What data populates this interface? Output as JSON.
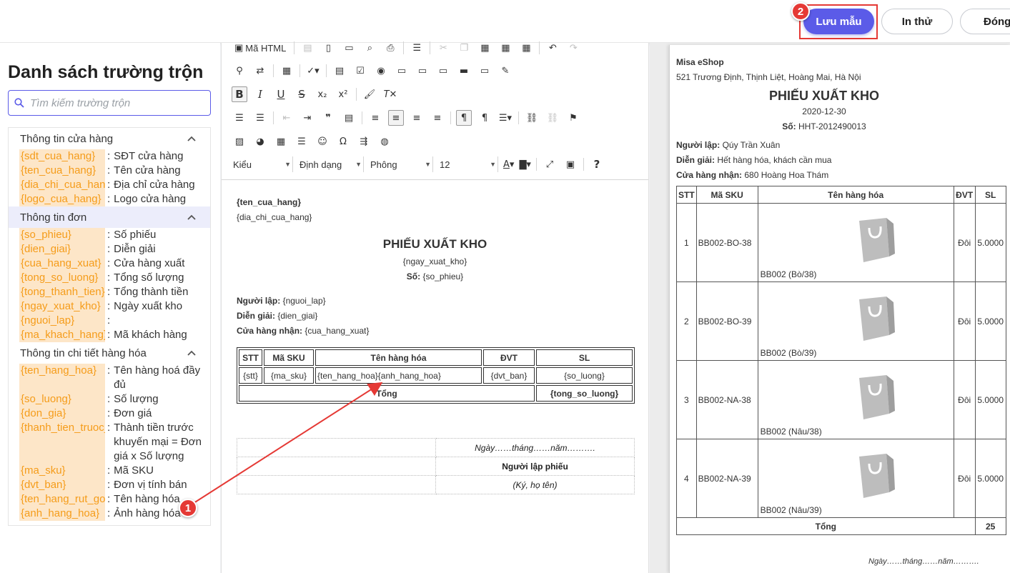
{
  "header": {
    "save_label": "Lưu mẫu",
    "test_print_label": "In thử",
    "close_label": "Đóng"
  },
  "markers": {
    "one": "1",
    "two": "2"
  },
  "colors": {
    "accent": "#5b5be8",
    "field_key_bg": "#fde6c8",
    "field_key_text": "#f59c1a",
    "marker": "#e53935"
  },
  "field_panel": {
    "title": "Danh sách trường trộn",
    "search_placeholder": "Tìm kiếm trường trộn",
    "groups": [
      {
        "title": "Thông tin cửa hàng",
        "fields": [
          {
            "key": "{sdt_cua_hang}",
            "desc": "SĐT cửa hàng"
          },
          {
            "key": "{ten_cua_hang}",
            "desc": "Tên cửa hàng"
          },
          {
            "key": "{dia_chi_cua_hang}",
            "desc": "Địa chỉ cửa hàng"
          },
          {
            "key": "{logo_cua_hang}",
            "desc": "Logo cửa hàng"
          }
        ]
      },
      {
        "title": "Thông tin đơn",
        "fields": [
          {
            "key": "{so_phieu}",
            "desc": "Số phiếu"
          },
          {
            "key": "{dien_giai}",
            "desc": "Diễn giải"
          },
          {
            "key": "{cua_hang_xuat}",
            "desc": "Cửa hàng xuất"
          },
          {
            "key": "{tong_so_luong}",
            "desc": "Tổng số lượng"
          },
          {
            "key": "{tong_thanh_tien}",
            "desc": "Tổng thành tiền"
          },
          {
            "key": "{ngay_xuat_kho}",
            "desc": "Ngày xuất kho"
          },
          {
            "key": "{nguoi_lap}",
            "desc": ""
          },
          {
            "key": "{ma_khach_hang}",
            "desc": "Mã khách hàng"
          }
        ]
      },
      {
        "title": "Thông tin chi tiết hàng hóa",
        "fields": [
          {
            "key": "{ten_hang_hoa}",
            "desc": "Tên hàng hoá đầy đủ"
          },
          {
            "key": "{so_luong}",
            "desc": "Số lượng"
          },
          {
            "key": "{don_gia}",
            "desc": "Đơn giá"
          },
          {
            "key": "{thanh_tien_truoc_km}",
            "desc": "Thành tiền trước khuyến mại = Đơn giá x Số lượng"
          },
          {
            "key": "{ma_sku}",
            "desc": "Mã SKU"
          },
          {
            "key": "{dvt_ban}",
            "desc": "Đơn vị tính bán"
          },
          {
            "key": "{ten_hang_rut_gon}",
            "desc": "Tên hàng hóa"
          },
          {
            "key": "{anh_hang_hoa}",
            "desc": "Ảnh hàng hóa"
          }
        ]
      }
    ]
  },
  "toolbar": {
    "html_label": "Mã HTML",
    "style_combo": "Kiểu",
    "format_combo": "Định dạng",
    "font_combo": "Phông",
    "size_combo": "12"
  },
  "template_doc": {
    "store_name": "{ten_cua_hang}",
    "store_address": "{dia_chi_cua_hang}",
    "title": "PHIẾU XUẤT KHO",
    "date": "{ngay_xuat_kho}",
    "number_label": "Số:",
    "number_value": "{so_phieu}",
    "creator_label": "Người lập:",
    "creator_value": "{nguoi_lap}",
    "desc_label": "Diễn giải:",
    "desc_value": "{dien_giai}",
    "store_recv_label": "Cửa hàng nhận:",
    "store_recv_value": "{cua_hang_xuat}",
    "table": {
      "headers": [
        "STT",
        "Mã SKU",
        "Tên hàng hóa",
        "ĐVT",
        "SL"
      ],
      "row": [
        "{stt}",
        "{ma_sku}",
        "{ten_hang_hoa}{anh_hang_hoa}",
        "{dvt_ban}",
        "{so_luong}"
      ],
      "total_label": "Tổng",
      "total_value": "{tong_so_luong}"
    },
    "sign_date": "Ngày……tháng……năm……….",
    "sign_title": "Người lập phiếu",
    "sign_note": "(Ký, họ tên)"
  },
  "preview_doc": {
    "store_name": "Misa eShop",
    "store_address": "521 Trương Định, Thịnh Liệt, Hoàng Mai, Hà Nội",
    "title": "PHIẾU XUẤT KHO",
    "date": "2020-12-30",
    "number_label": "Số:",
    "number_value": "HHT-2012490013",
    "creator_label": "Người lập:",
    "creator_value": "Qúy Trần Xuân",
    "desc_label": "Diễn giải:",
    "desc_value": "Hết hàng hóa, khách cần mua",
    "store_recv_label": "Cửa hàng nhận:",
    "store_recv_value": "680 Hoàng Hoa Thám",
    "table": {
      "headers": [
        "STT",
        "Mã SKU",
        "Tên hàng hóa",
        "ĐVT",
        "SL"
      ],
      "rows": [
        {
          "stt": "1",
          "sku": "BB002-BO-38",
          "name": "BB002 (Bò/38)",
          "unit": "Đôi",
          "qty": "5.0000"
        },
        {
          "stt": "2",
          "sku": "BB002-BO-39",
          "name": "BB002 (Bò/39)",
          "unit": "Đôi",
          "qty": "5.0000"
        },
        {
          "stt": "3",
          "sku": "BB002-NA-38",
          "name": "BB002 (Nâu/38)",
          "unit": "Đôi",
          "qty": "5.0000"
        },
        {
          "stt": "4",
          "sku": "BB002-NA-39",
          "name": "BB002 (Nâu/39)",
          "unit": "Đôi",
          "qty": "5.0000"
        }
      ],
      "total_label": "Tổng",
      "total_value": "25"
    },
    "sign_date": "Ngày……tháng……năm………."
  }
}
